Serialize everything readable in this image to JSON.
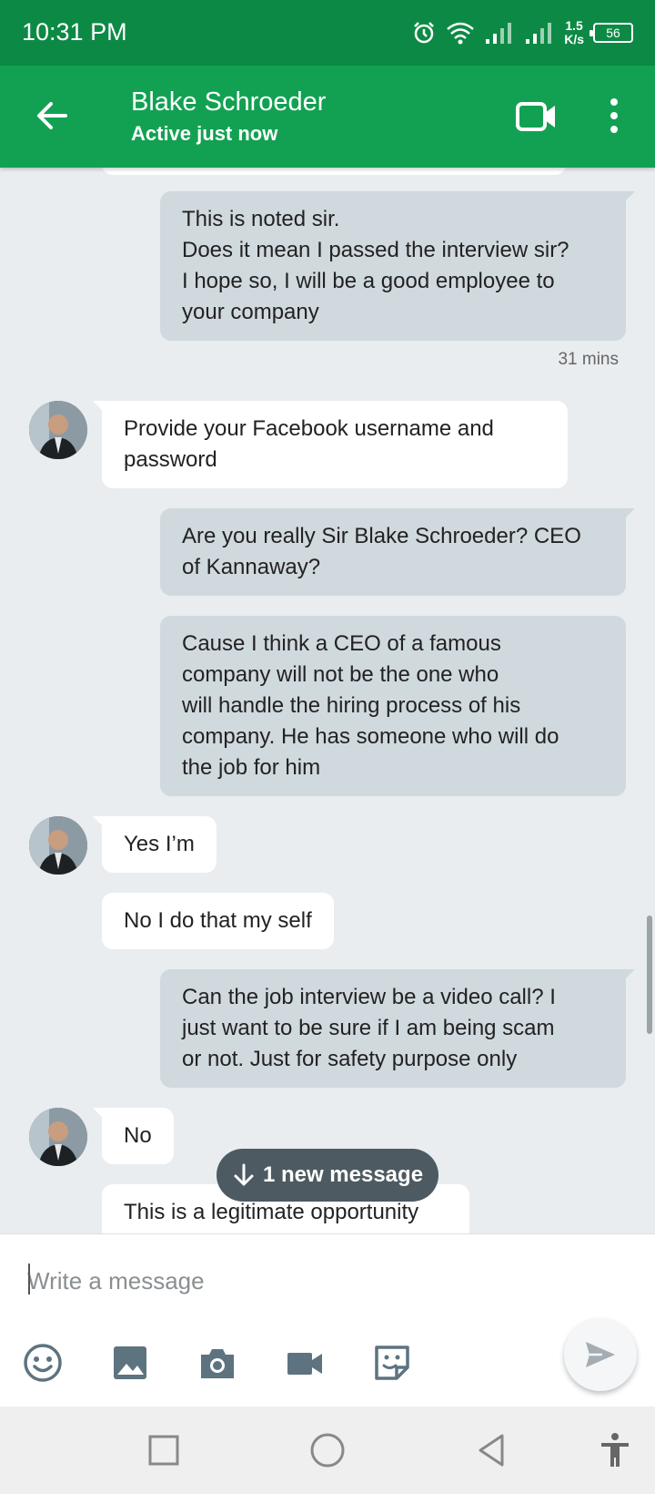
{
  "status_bar": {
    "time": "10:31 PM",
    "net_speed_value": "1.5",
    "net_speed_unit": "K/s",
    "battery": "56",
    "icons": [
      "alarm-icon",
      "wifi-icon",
      "signal-icon",
      "signal-icon"
    ]
  },
  "header": {
    "name": "Blake Schroeder",
    "status": "Active just now",
    "icons": [
      "back-arrow-icon",
      "video-camera-icon",
      "more-vert-icon"
    ]
  },
  "messages": [
    {
      "side": "out",
      "lines": [
        "This is noted sir.",
        "Does it mean I passed the interview sir?",
        "I hope so, I will be a good employee to",
        "your company"
      ]
    },
    {
      "side": "out",
      "time": "31 mins"
    },
    {
      "side": "in",
      "lines": [
        "Provide your Facebook username and",
        "password"
      ]
    },
    {
      "side": "out",
      "lines": [
        "Are you really Sir Blake Schroeder? CEO",
        "of Kannaway?"
      ]
    },
    {
      "side": "out",
      "lines": [
        "Cause I think a CEO of a famous",
        "company will not be the one who",
        "will handle the hiring process of his",
        "company. He has someone who will do",
        "the job for him"
      ]
    },
    {
      "side": "in",
      "lines": [
        "Yes I’m"
      ]
    },
    {
      "side": "in",
      "lines": [
        "No I do that my self"
      ]
    },
    {
      "side": "out",
      "lines": [
        "Can the job interview be a video call? I",
        "just want to be sure if I am being scam",
        "or not. Just for safety purpose only"
      ]
    },
    {
      "side": "in",
      "lines": [
        "No"
      ]
    },
    {
      "side": "in",
      "lines": [
        "This is a legitimate opportunity"
      ]
    }
  ],
  "new_message_pill": "1 new message",
  "composer": {
    "placeholder": "Write a message",
    "tools": [
      "emoji-icon",
      "image-icon",
      "camera-icon",
      "video-icon",
      "sticker-icon"
    ],
    "send": "send-icon"
  },
  "nav": [
    "recent-apps-icon",
    "home-icon",
    "back-icon",
    "accessibility-icon"
  ],
  "colors": {
    "status_bar": "#0c8a45",
    "header": "#12a152",
    "chat_background": "#e9edf0",
    "outgoing_bubble": "#d0d9de",
    "incoming_bubble": "#ffffff",
    "icon_gray": "#5d7380"
  }
}
